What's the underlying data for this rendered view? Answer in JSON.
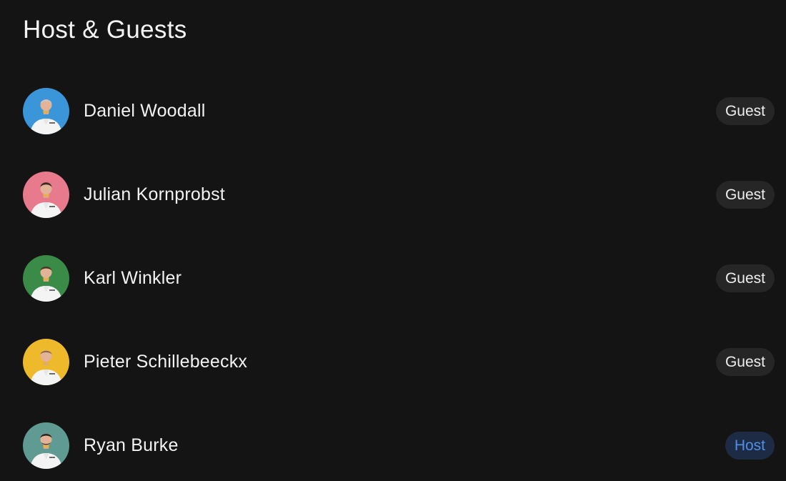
{
  "panel": {
    "title": "Host & Guests"
  },
  "people": [
    {
      "name": "Daniel Woodall",
      "role": "Guest",
      "role_type": "guest",
      "avatar_bg": "#3a96d9",
      "avatar_icon": "person-icon"
    },
    {
      "name": "Julian Kornprobst",
      "role": "Guest",
      "role_type": "guest",
      "avatar_bg": "#e77a8c",
      "avatar_icon": "person-icon"
    },
    {
      "name": "Karl Winkler",
      "role": "Guest",
      "role_type": "guest",
      "avatar_bg": "#3a8a48",
      "avatar_icon": "person-icon"
    },
    {
      "name": "Pieter Schillebeeckx",
      "role": "Guest",
      "role_type": "guest",
      "avatar_bg": "#efb92c",
      "avatar_icon": "person-icon"
    },
    {
      "name": "Ryan Burke",
      "role": "Host",
      "role_type": "host",
      "avatar_bg": "#5f9a93",
      "avatar_icon": "person-icon"
    }
  ],
  "colors": {
    "background": "#141414",
    "guest_badge_bg": "#262626",
    "host_badge_bg": "#1d2b44",
    "host_badge_text": "#4f8fe8"
  }
}
